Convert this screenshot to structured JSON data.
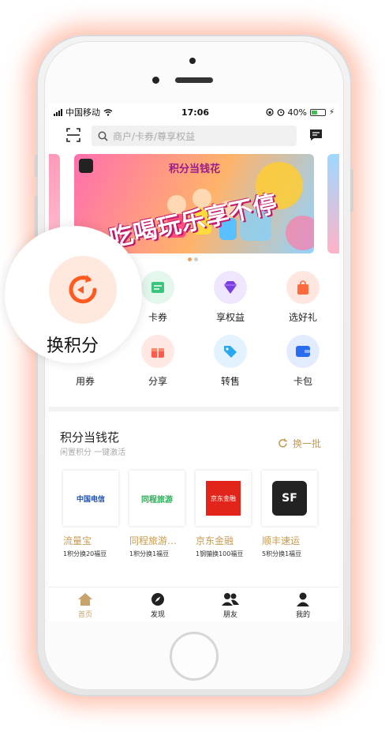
{
  "status": {
    "carrier": "中国移动",
    "time": "17:06",
    "battery": "40%"
  },
  "search": {
    "placeholder": "商户/卡券/尊享权益"
  },
  "banner": {
    "title": "积分当钱花",
    "slogan": "吃喝玩乐享不停"
  },
  "grid": [
    {
      "label": "",
      "icon": "coupon-icon",
      "color": "#3cc47c"
    },
    {
      "label": "享权益",
      "icon": "diamond-icon",
      "color": "#7a3fe0"
    },
    {
      "label": "选好礼",
      "icon": "gift-bag-icon",
      "color": "#ff6a3d"
    },
    {
      "label": "用券",
      "icon": "ticket-icon",
      "color": "#ff7a3d"
    },
    {
      "label": "分享",
      "icon": "gift-box-icon",
      "color": "#ff5a4a"
    },
    {
      "label": "转售",
      "icon": "tag-icon",
      "color": "#2aa8f0"
    },
    {
      "label": "卡包",
      "icon": "wallet-icon",
      "color": "#2a6cf0"
    }
  ],
  "grid_partial_label": "卡券",
  "zoom": {
    "label": "换积分",
    "icon": "refresh-points-icon",
    "color": "#ff5a1f"
  },
  "section": {
    "title": "积分当钱花",
    "subtitle": "闲置积分 一键激活",
    "refresh_label": "换一批"
  },
  "cards": [
    {
      "name": "流量宝",
      "desc": "1积分换20福豆",
      "logo_text": "中国电信"
    },
    {
      "name": "同程旅游…",
      "desc": "1积分换1福豆",
      "logo_text": "同程旅游"
    },
    {
      "name": "京东金融",
      "desc": "1钢镚换100福豆",
      "logo_text": "京东金融"
    },
    {
      "name": "顺丰速运",
      "desc": "5积分换1福豆",
      "logo_text": "SF"
    }
  ],
  "tabs": [
    {
      "label": "首页",
      "icon": "home-icon",
      "active": true
    },
    {
      "label": "发现",
      "icon": "compass-icon",
      "active": false
    },
    {
      "label": "朋友",
      "icon": "friends-icon",
      "active": false
    },
    {
      "label": "我的",
      "icon": "profile-icon",
      "active": false
    }
  ],
  "colors": {
    "accent": "#c8a36b",
    "glow": "#ff7850"
  }
}
